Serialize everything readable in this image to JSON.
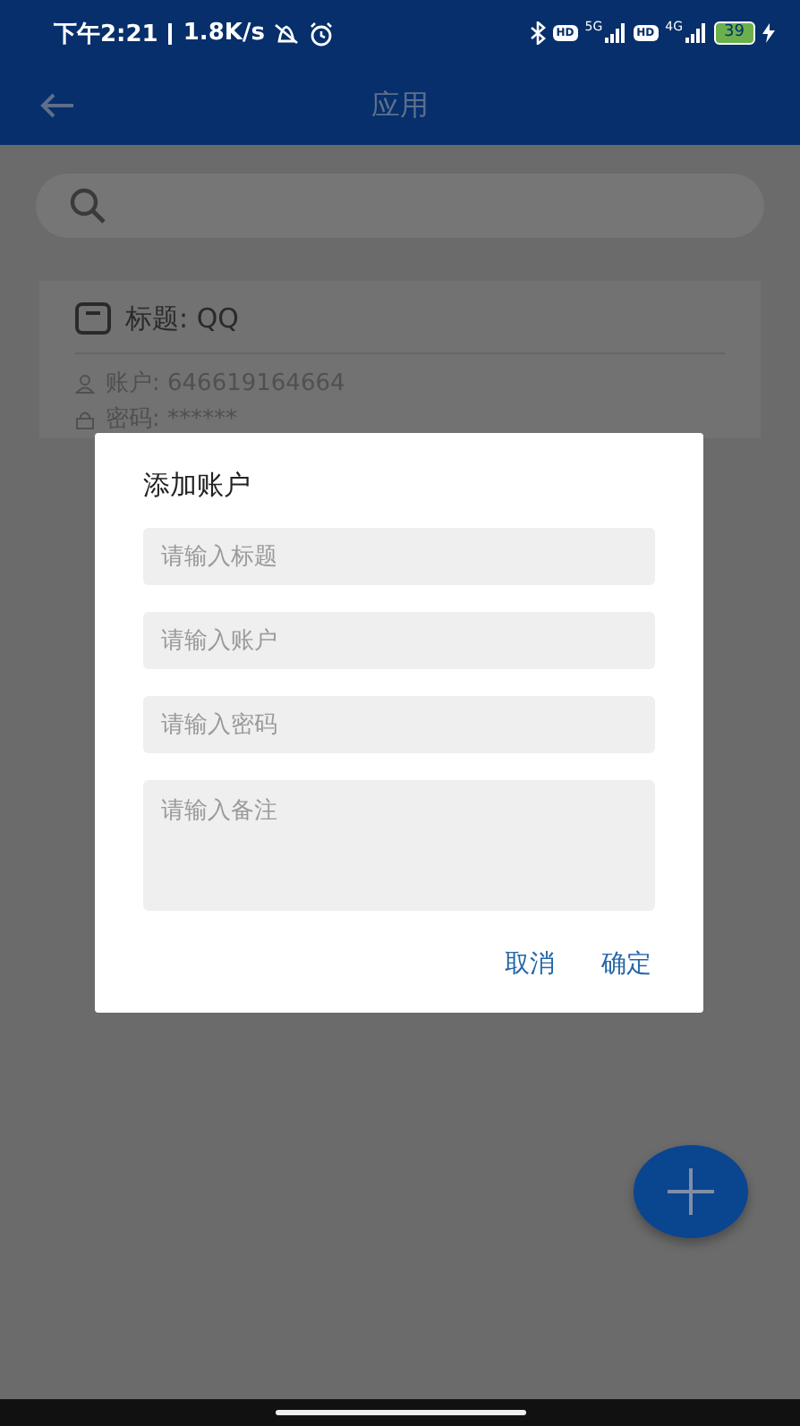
{
  "status_bar": {
    "time": "下午2:21",
    "speed": "1.8K/s",
    "hd_1": "HD",
    "network_1": "5G",
    "hd_2": "HD",
    "network_2": "4G",
    "battery": "39"
  },
  "app_bar": {
    "title": "应用"
  },
  "accounts": [
    {
      "title": "标题: QQ",
      "account": "账户: 646619164664",
      "password": "密码: ******"
    }
  ],
  "dialog": {
    "title": "添加账户",
    "fields": [
      {
        "kind": "input",
        "placeholder": "请输入标题"
      },
      {
        "kind": "input",
        "placeholder": "请输入账户"
      },
      {
        "kind": "input",
        "placeholder": "请输入密码"
      },
      {
        "kind": "textarea",
        "placeholder": "请输入备注"
      }
    ],
    "buttons": [
      "取消",
      "确定"
    ]
  }
}
